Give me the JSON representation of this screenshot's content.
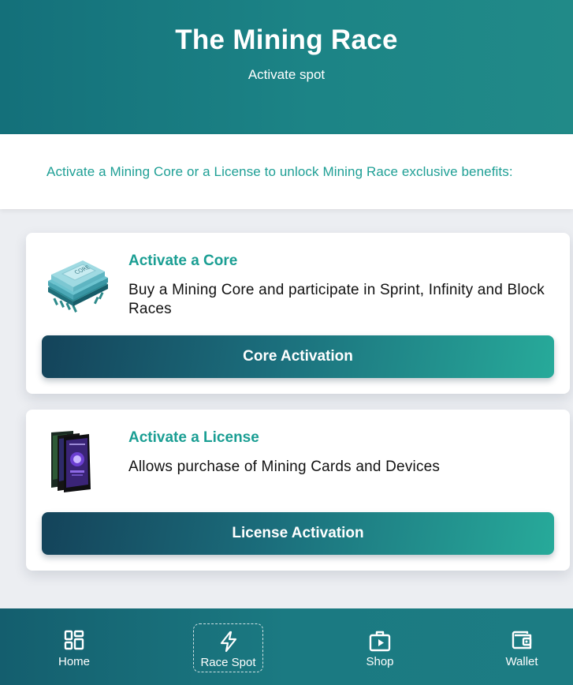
{
  "header": {
    "title": "The Mining Race",
    "subtitle": "Activate spot"
  },
  "intro": {
    "text": "Activate a Mining Core or a License to unlock Mining Race exclusive benefits:"
  },
  "cards": [
    {
      "title": "Activate a Core",
      "description": "Buy a Mining Core and participate in Sprint, Infinity and Block Races",
      "button_label": "Core Activation",
      "image_label": "CORE",
      "icon": "mining-core-chip-icon"
    },
    {
      "title": "Activate a License",
      "description": "Allows purchase of Mining Cards and Devices",
      "button_label": "License Activation",
      "icon": "license-cards-icon"
    }
  ],
  "nav": {
    "items": [
      {
        "label": "Home",
        "icon": "dashboard-icon"
      },
      {
        "label": "Race Spot",
        "icon": "lightning-icon",
        "active": true
      },
      {
        "label": "Shop",
        "icon": "shop-bag-icon"
      },
      {
        "label": "Wallet",
        "icon": "wallet-icon"
      }
    ]
  },
  "colors": {
    "accent": "#1a9e93",
    "header": "#1c8486",
    "button_start": "#14435a",
    "button_end": "#27aa9a"
  }
}
